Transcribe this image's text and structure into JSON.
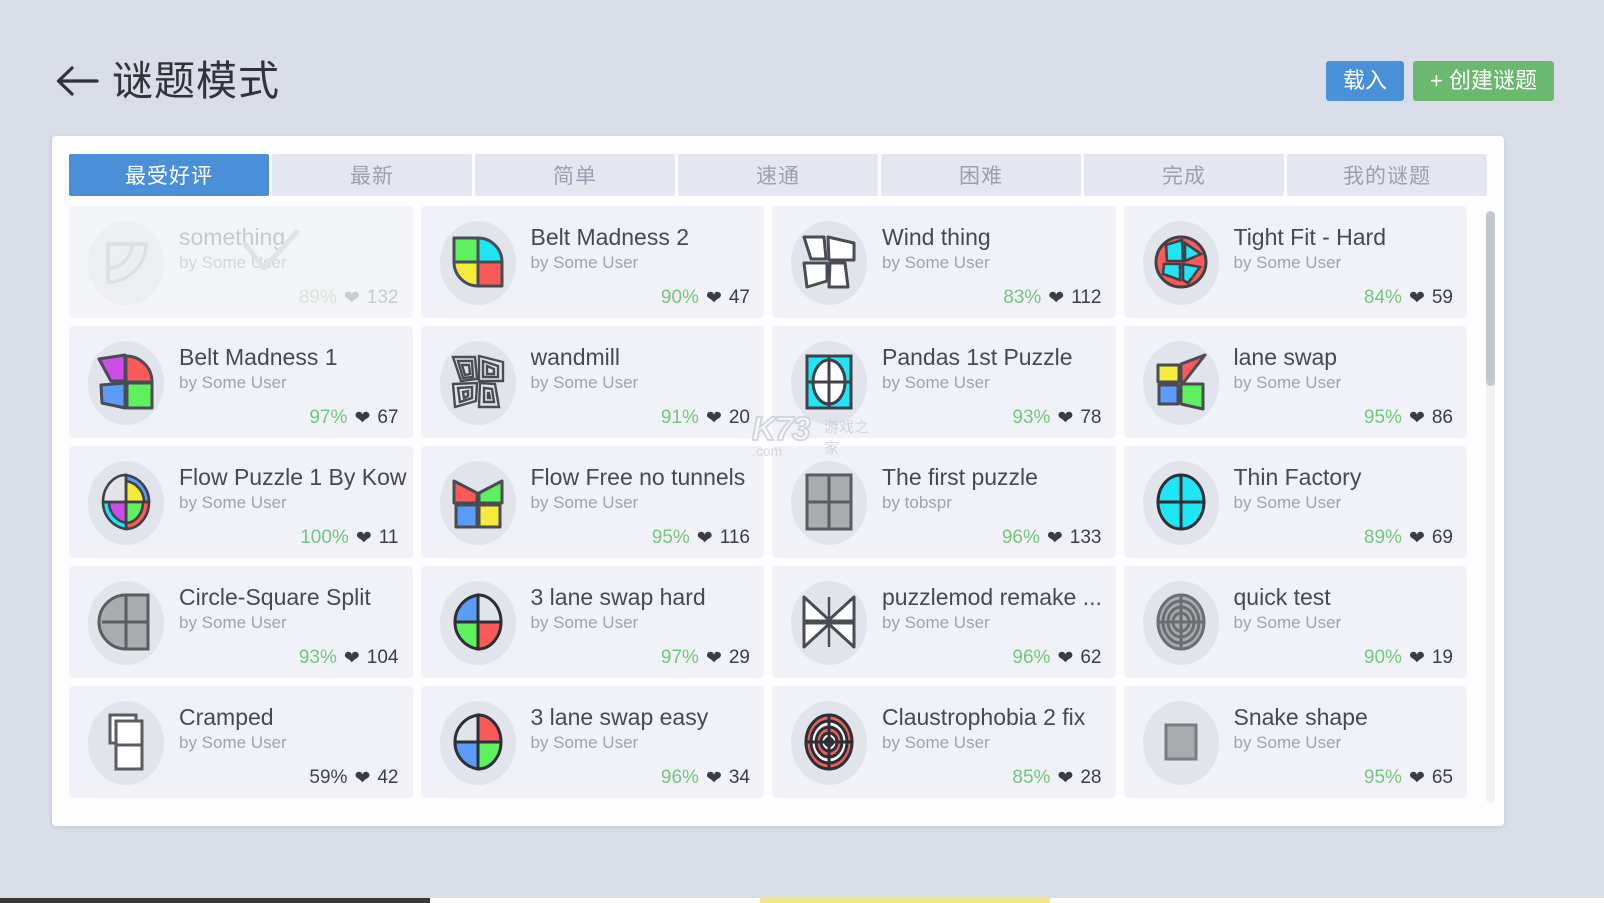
{
  "header": {
    "back_icon": "arrow-left-icon",
    "title": "谜题模式",
    "load_label": "载入",
    "create_label": "+ 创建谜题"
  },
  "tabs": [
    {
      "label": "最受好评",
      "active": true
    },
    {
      "label": "最新",
      "active": false
    },
    {
      "label": "简单",
      "active": false
    },
    {
      "label": "速通",
      "active": false
    },
    {
      "label": "困难",
      "active": false
    },
    {
      "label": "完成",
      "active": false
    },
    {
      "label": "我的谜题",
      "active": false
    }
  ],
  "colors": {
    "accent_blue": "#4a90d9",
    "accent_green": "#6ab96f",
    "percent_green": "#73c67d",
    "page_bg": "#d9dde8",
    "panel_bg": "#fdfdfe",
    "card_bg": "#f1f2f8",
    "text_dark": "#474952",
    "text_muted": "#9ea3b2"
  },
  "watermark": {
    "logo": "K73",
    "domain": ".com",
    "cn": "游戏之家"
  },
  "scrollbar": {
    "name": "vertical-scrollbar",
    "thumb_top_pct": 0,
    "thumb_height_pct": 29
  },
  "puzzles": [
    {
      "title": "something",
      "author": "by Some User",
      "percent": "89%",
      "likes": "132",
      "completed": true,
      "thumb": "quarter-arc-gray"
    },
    {
      "title": "Belt Madness 2",
      "author": "by Some User",
      "percent": "90%",
      "likes": "47",
      "completed": false,
      "thumb": "belt-madness-2"
    },
    {
      "title": "Wind thing",
      "author": "by Some User",
      "percent": "83%",
      "likes": "112",
      "completed": false,
      "thumb": "wind-thing"
    },
    {
      "title": "Tight Fit - Hard",
      "author": "by Some User",
      "percent": "84%",
      "likes": "59",
      "completed": false,
      "thumb": "tight-fit-hard"
    },
    {
      "title": "Belt Madness 1",
      "author": "by Some User",
      "percent": "97%",
      "likes": "67",
      "completed": false,
      "thumb": "belt-madness-1"
    },
    {
      "title": "wandmill",
      "author": "by Some User",
      "percent": "91%",
      "likes": "20",
      "completed": false,
      "thumb": "wandmill-spiral"
    },
    {
      "title": "Pandas 1st Puzzle",
      "author": "by Some User",
      "percent": "93%",
      "likes": "78",
      "completed": false,
      "thumb": "pandas-1st-puzzle"
    },
    {
      "title": "lane swap",
      "author": "by Some User",
      "percent": "95%",
      "likes": "86",
      "completed": false,
      "thumb": "lane-swap"
    },
    {
      "title": "Flow Puzzle 1 By Kow",
      "author": "by Some User",
      "percent": "100%",
      "likes": "11",
      "completed": false,
      "thumb": "flow-puzzle-1"
    },
    {
      "title": "Flow Free no tunnels",
      "author": "by Some User",
      "percent": "95%",
      "likes": "116",
      "completed": false,
      "thumb": "flow-free-no-tunnels"
    },
    {
      "title": "The first puzzle",
      "author": "by tobspr",
      "percent": "96%",
      "likes": "133",
      "completed": false,
      "thumb": "four-square-gray"
    },
    {
      "title": "Thin Factory",
      "author": "by Some User",
      "percent": "89%",
      "likes": "69",
      "completed": false,
      "thumb": "cyan-circle-cross"
    },
    {
      "title": "Circle-Square Split",
      "author": "by Some User",
      "percent": "93%",
      "likes": "104",
      "completed": false,
      "thumb": "circle-square-split"
    },
    {
      "title": "3 lane swap hard",
      "author": "by Some User",
      "percent": "97%",
      "likes": "29",
      "completed": false,
      "thumb": "three-lane-swap-hard"
    },
    {
      "title": "puzzlemod remake ...",
      "author": "by Some User",
      "percent": "96%",
      "likes": "62",
      "completed": false,
      "thumb": "four-point-star"
    },
    {
      "title": "quick test",
      "author": "by Some User",
      "percent": "90%",
      "likes": "19",
      "completed": false,
      "thumb": "gray-target-rings"
    },
    {
      "title": "Cramped",
      "author": "by Some User",
      "percent": "59%",
      "likes": "42",
      "completed": false,
      "thumb": "cramped-rects",
      "percent_low": true
    },
    {
      "title": "3 lane swap easy",
      "author": "by Some User",
      "percent": "96%",
      "likes": "34",
      "completed": false,
      "thumb": "three-lane-swap-easy"
    },
    {
      "title": "Claustrophobia 2 fix",
      "author": "by Some User",
      "percent": "85%",
      "likes": "28",
      "completed": false,
      "thumb": "red-target-rings"
    },
    {
      "title": "Snake shape",
      "author": "by Some User",
      "percent": "95%",
      "likes": "65",
      "completed": false,
      "thumb": "small-gray-square"
    }
  ]
}
